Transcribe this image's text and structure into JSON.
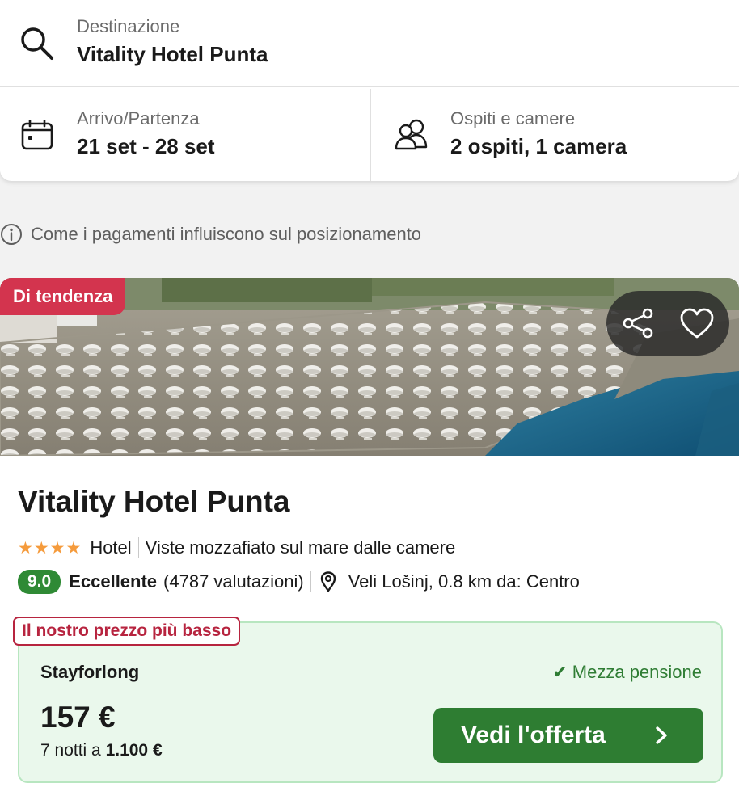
{
  "search": {
    "destination_label": "Destinazione",
    "destination_value": "Vitality Hotel Punta",
    "dates_label": "Arrivo/Partenza",
    "dates_value": "21 set - 28 set",
    "guests_label": "Ospiti e camere",
    "guests_value": "2 ospiti, 1 camera"
  },
  "info_link": "Come i pagamenti influiscono sul posizionamento",
  "hotel": {
    "badge": "Di tendenza",
    "name": "Vitality Hotel Punta",
    "stars": 4,
    "type": "Hotel",
    "highlight": "Viste mozzafiato sul mare dalle camere",
    "score": "9.0",
    "rating_word": "Eccellente",
    "reviews": "(4787 valutazioni)",
    "location": "Veli Lošinj, 0.8 km da: Centro"
  },
  "offer": {
    "badge": "Il nostro prezzo più basso",
    "provider": "Stayforlong",
    "board": "Mezza pensione",
    "price": "157 €",
    "total_prefix": "7 notti a ",
    "total_value": "1.100 €",
    "button_label": "Vedi l'offerta"
  },
  "colors": {
    "trend_badge": "#d3344e",
    "score_badge": "#2f8a35",
    "offer_button": "#2e7d32",
    "offer_card_bg": "#eaf8ec",
    "lowest_badge": "#b7243f",
    "stars": "#f59b3c"
  }
}
